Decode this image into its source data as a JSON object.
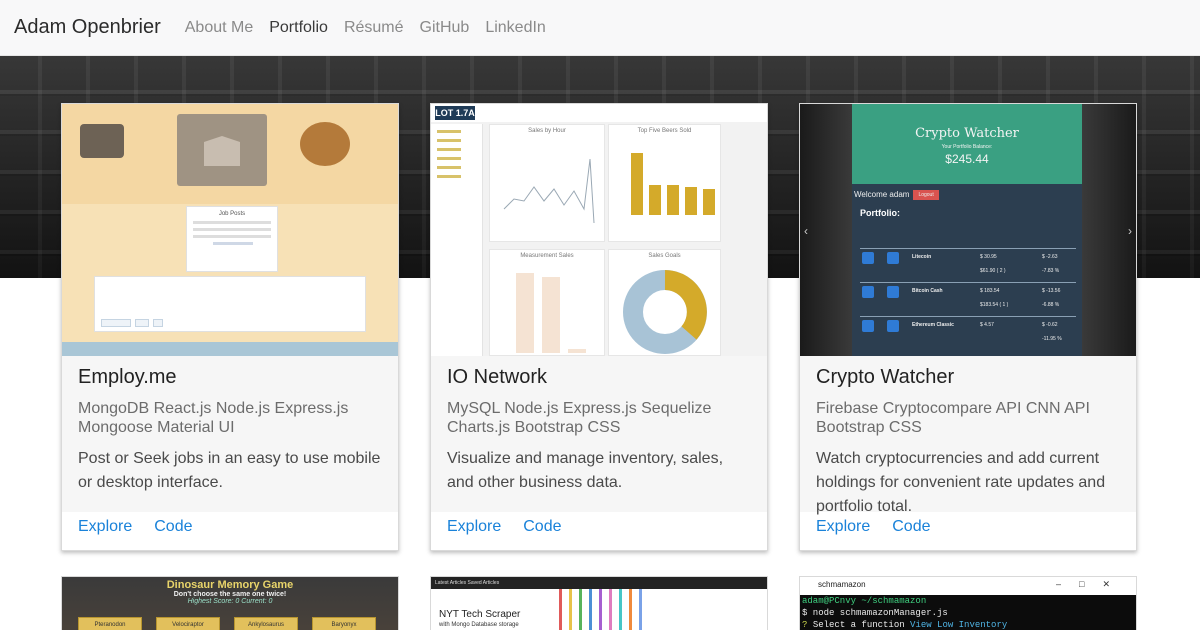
{
  "navbar": {
    "brand": "Adam Openbrier",
    "links": [
      {
        "label": "About Me",
        "active": false
      },
      {
        "label": "Portfolio",
        "active": true
      },
      {
        "label": "Résumé",
        "active": false
      },
      {
        "label": "GitHub",
        "active": false
      },
      {
        "label": "LinkedIn",
        "active": false
      }
    ]
  },
  "cards": [
    {
      "title": "Employ.me",
      "tech": "MongoDB React.js Node.js Express.js Mongoose Material UI",
      "description": "Post or Seek jobs in an easy to use mobile or desktop interface.",
      "explore_label": "Explore",
      "code_label": "Code",
      "thumb": {
        "panel_title": "Job Posts"
      }
    },
    {
      "title": "IO Network",
      "tech": "MySQL Node.js Express.js Sequelize Charts.js Bootstrap CSS",
      "description": "Visualize and manage inventory, sales, and other business data.",
      "explore_label": "Explore",
      "code_label": "Code",
      "thumb": {
        "logo": "LOT 1.7A",
        "panels": [
          "Sales by Hour",
          "Top Five Beers Sold",
          "Measurement Sales",
          "Sales Goals"
        ]
      }
    },
    {
      "title": "Crypto Watcher",
      "tech": "Firebase Cryptocompare API CNN API Bootstrap CSS",
      "description": "Watch cryptocurrencies and add current holdings for convenient rate updates and portfolio total.",
      "explore_label": "Explore",
      "code_label": "Code",
      "thumb": {
        "app_title": "Crypto Watcher",
        "balance_label": "Your Portfolio Balance:",
        "balance": "$245.44",
        "welcome": "Welcome adam",
        "logout": "Logout",
        "portfolio_label": "Portfolio:",
        "rows": [
          {
            "coin": "Litecoin",
            "price": "$ 30.95",
            "holdings": "$61.90 ( 2 )",
            "change": "$ -2.63",
            "pct": "-7.83 %"
          },
          {
            "coin": "Bitcoin Cash",
            "price": "$ 183.54",
            "holdings": "$183.54 ( 1 )",
            "change": "$ -13.56",
            "pct": "-6.88 %"
          },
          {
            "coin": "Ethereum Classic",
            "price": "$ 4.57",
            "holdings": "",
            "change": "$ -0.62",
            "pct": "-11.95 %"
          }
        ]
      }
    }
  ],
  "bottom_cards": [
    {
      "title": "Dinosaur Memory Game",
      "subtitle": "Don't choose the same one twice!",
      "hint": "Highest Score: 0 Current: 0",
      "tiles": [
        "Pteranodon",
        "Velociraptor",
        "Ankylosaurus",
        "Baryonyx"
      ]
    },
    {
      "topbar": "Latest Articles   Saved Articles",
      "headline": "NYT Tech Scraper",
      "subhead": "with Mongo Database storage"
    },
    {
      "window_title": "schmamazon",
      "prompt": "adam@PCnvy ~/schmamazon",
      "command": "$ node schmamazonManager.js",
      "line": "Select a function",
      "option": "View Low Inventory"
    }
  ],
  "colors": {
    "link": "#1a82d9",
    "navbar_bg": "#f8f8f9",
    "crypto_green": "#3aa082",
    "crypto_navy": "#2c3e50"
  }
}
